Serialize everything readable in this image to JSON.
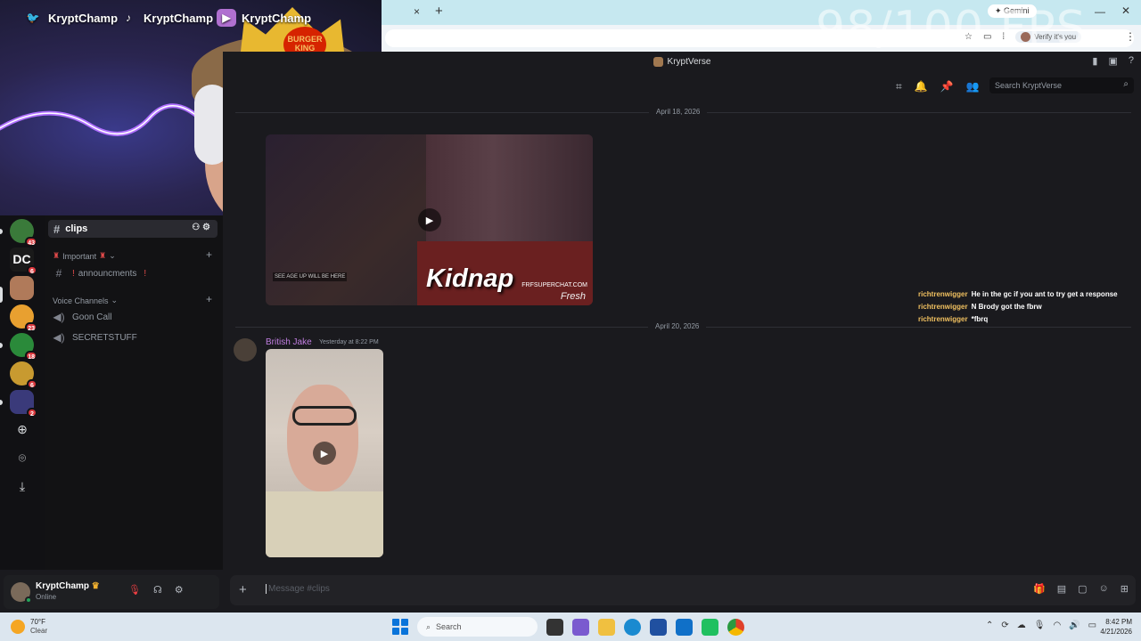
{
  "stream": {
    "socials": [
      {
        "name": "KryptChamp",
        "icon": "twitter-icon"
      },
      {
        "name": "KryptChamp",
        "icon": "tiktok-icon"
      },
      {
        "name": "KryptChamp",
        "icon": "youtube-icon"
      }
    ],
    "crown_text": "BURGER KING",
    "fps_overlay": "98/100 FPS"
  },
  "browser": {
    "gemini_label": "Gemini",
    "profile_label": "Verify it's you",
    "tab_close": "×",
    "new_tab": "+"
  },
  "app": {
    "server_name": "KryptVerse",
    "search_placeholder": "Search KryptVerse"
  },
  "servers": [
    {
      "badge": "43",
      "color": "#3a7a3a"
    },
    {
      "badge": "6",
      "color": "#1a1a1a",
      "text": "DC"
    },
    {
      "badge": "",
      "color": "#b07a5a"
    },
    {
      "badge": "23",
      "color": "#e8a030"
    },
    {
      "badge": "18",
      "color": "#2a8a3a"
    },
    {
      "badge": "6",
      "color": "#c89a30"
    },
    {
      "badge": "2",
      "color": "#3a3a7a"
    }
  ],
  "sidebar": {
    "active_channel": "clips",
    "categories": [
      {
        "label": "Important",
        "channels": [
          {
            "name": "announcments",
            "type": "text"
          }
        ]
      },
      {
        "label": "Voice Channels",
        "channels": [
          {
            "name": "Goon Call",
            "type": "voice"
          },
          {
            "name": "SECRETSTUFF",
            "type": "voice-locked"
          }
        ]
      }
    ]
  },
  "user": {
    "name": "KryptChamp",
    "status": "Online"
  },
  "chat": {
    "dates": [
      "April 18, 2026",
      "April 20, 2026"
    ],
    "video1_overlay": "Kidnap",
    "video1_site": "FRFSUPERCHAT.COM",
    "video1_corner": "Fresh",
    "video1_caption": "SEE AGE UP WILL BE HERE",
    "message": {
      "author": "British Jake",
      "time": "Yesterday at 8:22 PM"
    },
    "composer_placeholder": "Message #clips"
  },
  "stream_chat": [
    {
      "user": "richtrenwigger",
      "text": "He in the gc if you ant to try get a response"
    },
    {
      "user": "richtrenwigger",
      "text": "N Brody got the fbrw"
    },
    {
      "user": "richtrenwigger",
      "text": "*fbrq"
    }
  ],
  "taskbar": {
    "temp": "70°F",
    "condition": "Clear",
    "search_label": "Search",
    "time": "8:42 PM",
    "date": "4/21/2026"
  }
}
